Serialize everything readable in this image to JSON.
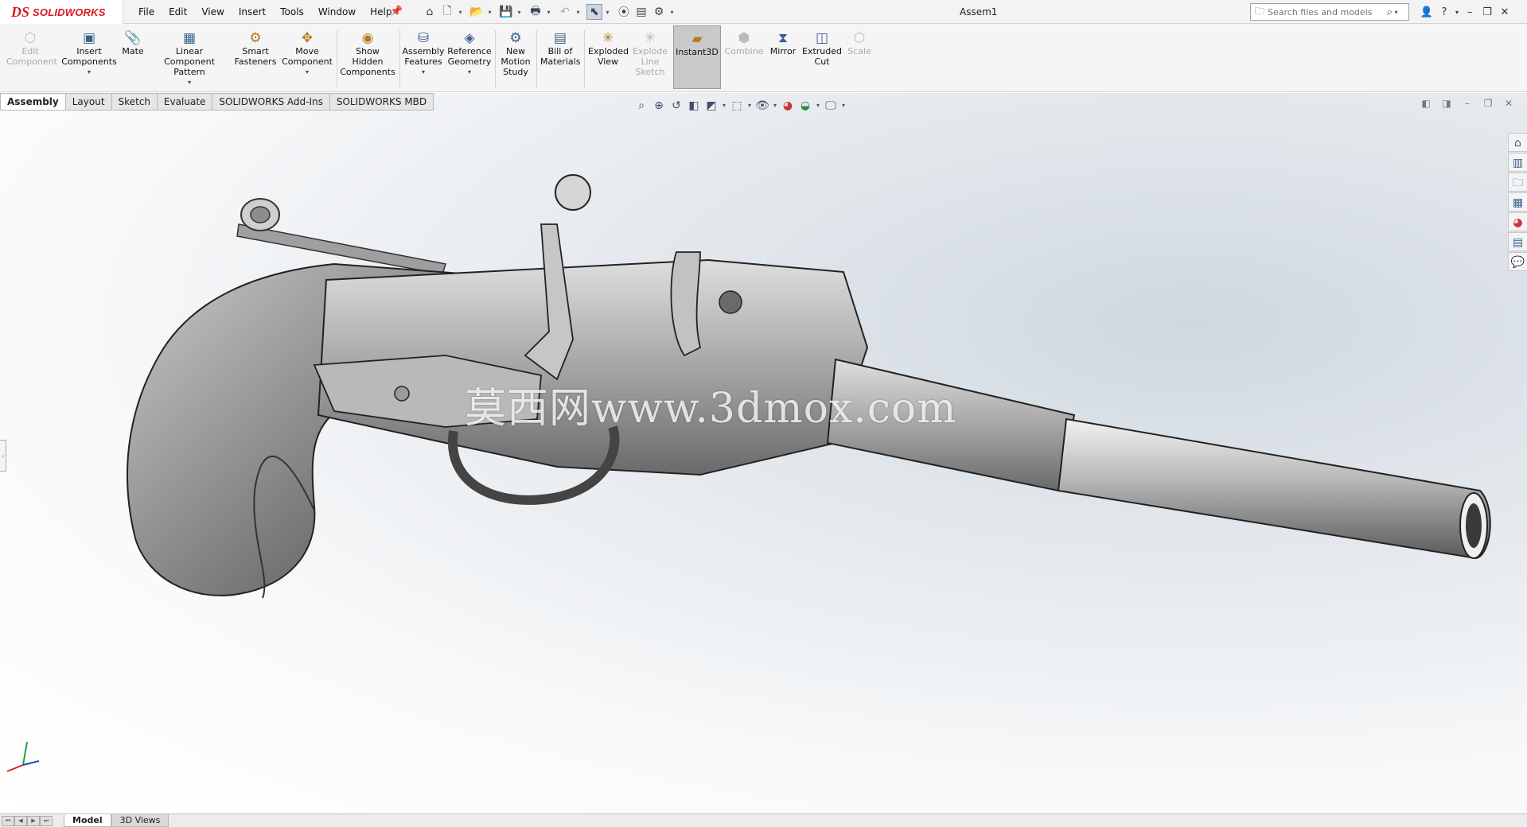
{
  "app": {
    "logo_ds": "DS",
    "logo_text": "SOLIDWORKS",
    "document_title": "Assem1"
  },
  "menu": [
    "File",
    "Edit",
    "View",
    "Insert",
    "Tools",
    "Window",
    "Help"
  ],
  "search": {
    "placeholder": "Search files and models"
  },
  "commands": {
    "edit_component": "Edit Component",
    "insert_components": "Insert Components",
    "mate": "Mate",
    "linear_pattern": "Linear Component Pattern",
    "smart_fasteners": "Smart Fasteners",
    "move_component": "Move Component",
    "show_hidden": "Show Hidden Components",
    "assembly_features": "Assembly Features",
    "reference_geometry": "Reference Geometry",
    "new_motion_study": "New Motion Study",
    "bill_of_materials": "Bill of Materials",
    "exploded_view": "Exploded View",
    "explode_line_sketch": "Explode Line Sketch",
    "instant3d": "Instant3D",
    "combine": "Combine",
    "mirror": "Mirror",
    "extruded_cut": "Extruded Cut",
    "scale": "Scale"
  },
  "tabs": [
    "Assembly",
    "Layout",
    "Sketch",
    "Evaluate",
    "SOLIDWORKS Add-Ins",
    "SOLIDWORKS MBD"
  ],
  "active_tab": "Assembly",
  "viewport": {
    "watermark": "莫西网www.3dmox.com"
  },
  "bottom_tabs": [
    "Model",
    "3D Views"
  ],
  "colors": {
    "brand": "#d7191c",
    "accent": "#3a5f8f"
  }
}
